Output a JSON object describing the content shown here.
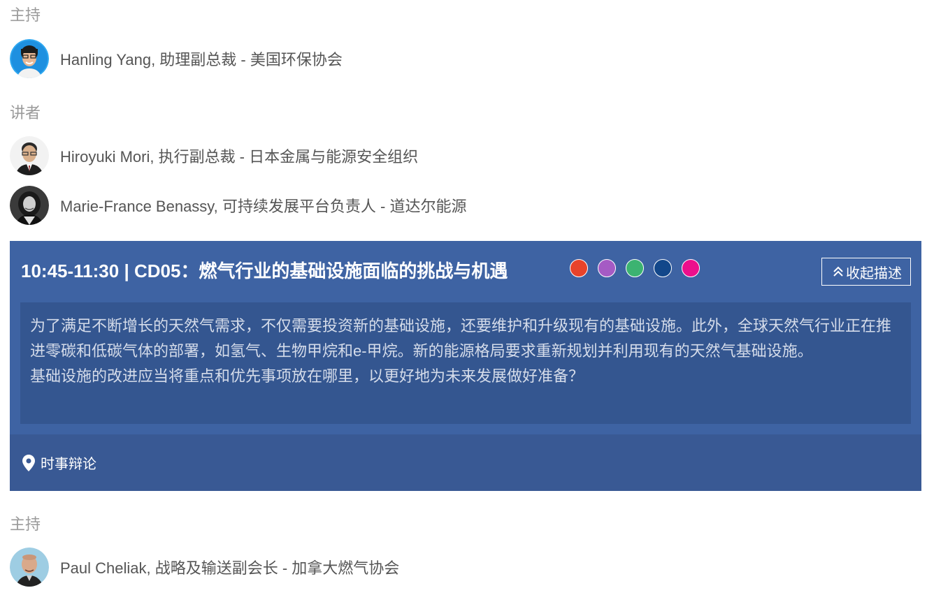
{
  "section1": {
    "moderator_label": "主持",
    "moderator": {
      "name": "Hanling Yang, 助理副总裁 - 美国环保协会",
      "avatar": "person-photo-icon"
    },
    "speakers_label": "讲者",
    "speakers": [
      {
        "name": "Hiroyuki Mori, 执行副总裁 - 日本金属与能源安全组织",
        "avatar": "person-photo-icon"
      },
      {
        "name": "Marie-France Benassy, 可持续发展平台负责人 - 道达尔能源",
        "avatar": "person-photo-icon"
      }
    ]
  },
  "session": {
    "title": "10:45-11:30 | CD05：燃气行业的基础设施面临的挑战与机遇",
    "tag_colors": [
      "#e8432a",
      "#a55bc4",
      "#3cb371",
      "#12478a",
      "#ec0f8c"
    ],
    "collapse_label": "收起描述",
    "collapse_icon": "double-chevron-up-icon",
    "description": [
      "为了满足不断增长的天然气需求，不仅需要投资新的基础设施，还要维护和升级现有的基础设施。此外，全球天然气行业正在推进零碳和低碳气体的部署，如氢气、生物甲烷和e-甲烷。新的能源格局要求重新规划并利用现有的天然气基础设施。",
      "基础设施的改进应当将重点和优先事项放在哪里，以更好地为未来发展做好准备？"
    ],
    "location_icon": "map-pin-icon",
    "location": "时事辩论"
  },
  "section2": {
    "moderator_label": "主持",
    "moderator": {
      "name": "Paul Cheliak, 战略及输送副会长 - 加拿大燃气协会",
      "avatar": "person-photo-icon"
    }
  },
  "colors": {
    "panel": "#3e63a3",
    "description_bg": "#345690",
    "footer_bg": "#395994"
  }
}
